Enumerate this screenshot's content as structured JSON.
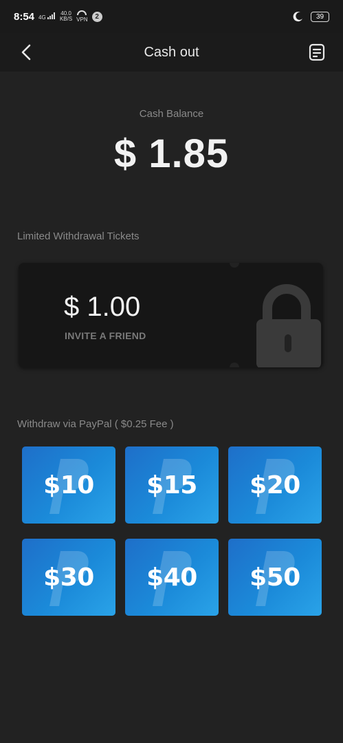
{
  "status_bar": {
    "time": "8:54",
    "network": "4G",
    "speed_value": "40.0",
    "speed_unit": "KB/S",
    "vpn": "VPN",
    "notif_count": "2",
    "battery": "39"
  },
  "header": {
    "title": "Cash out",
    "back_icon": "chevron-left-icon",
    "history_icon": "document-icon"
  },
  "balance": {
    "label": "Cash Balance",
    "value": "$ 1.85"
  },
  "tickets": {
    "section_label": "Limited Withdrawal Tickets",
    "items": [
      {
        "amount": "$ 1.00",
        "subtitle": "INVITE A FRIEND",
        "locked": true
      }
    ]
  },
  "paypal": {
    "section_label": "Withdraw via PayPal ( $0.25 Fee )",
    "options": [
      {
        "label": "$10"
      },
      {
        "label": "$15"
      },
      {
        "label": "$20"
      },
      {
        "label": "$30"
      },
      {
        "label": "$40"
      },
      {
        "label": "$50"
      }
    ]
  },
  "colors": {
    "background": "#222222",
    "paypal_blue": "#1b8ad9",
    "muted_text": "#8a8a8a"
  }
}
